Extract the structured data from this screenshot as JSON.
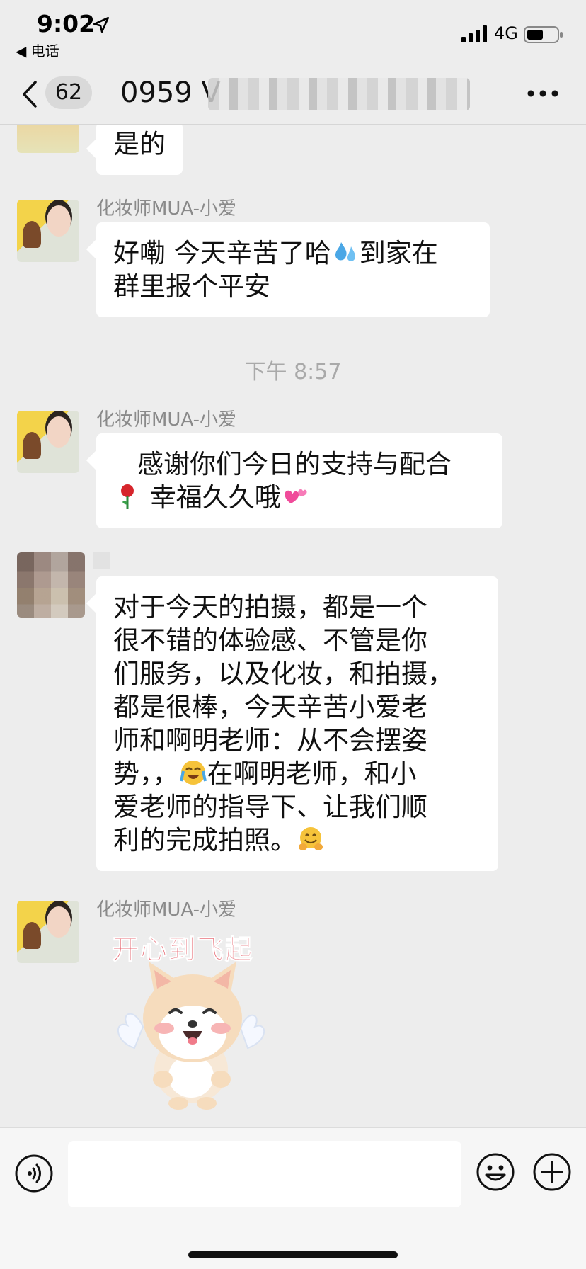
{
  "status_bar": {
    "time": "9:02",
    "back_app": "◀ 电话",
    "network": "4G"
  },
  "nav": {
    "unread_count": "62",
    "title": "0959 V"
  },
  "messages": [
    {
      "type": "text",
      "text": "是的"
    },
    {
      "type": "text",
      "sender": "化妆师MUA-小爱",
      "text_1": "好嘞 今天辛苦了哈",
      "text_2": "到家在",
      "text_3": "群里报个平安"
    },
    {
      "type": "timestamp",
      "text": "下午 8:57"
    },
    {
      "type": "text",
      "sender": "化妆师MUA-小爱",
      "text_1": "感谢你们今日的支持与配合",
      "text_2": "幸福久久哦"
    },
    {
      "type": "text",
      "lines": [
        "对于今天的拍摄，都是一个",
        "很不错的体验感、不管是你",
        "们服务，以及化妆，和拍摄，",
        "都是很棒，今天辛苦小爱老",
        "师和啊明老师：从不会摆姿",
        "在啊明老师，和小",
        "爱老师的指导下、让我们顺",
        "利的完成拍照。"
      ],
      "line_6_prefix": "势，，"
    },
    {
      "type": "sticker",
      "sender": "化妆师MUA-小爱",
      "caption": "开心到飞起"
    }
  ],
  "input": {
    "placeholder": ""
  },
  "icons": {
    "back": "chevron-left-icon",
    "more": "more-dots-icon",
    "voice": "voice-icon",
    "emoji": "emoji-icon",
    "plus": "plus-icon",
    "emoji_sweat": "sweat-droplets-emoji",
    "emoji_rose": "rose-emoji",
    "emoji_hearts": "two-hearts-emoji",
    "emoji_laugh": "loudly-crying-emoji",
    "emoji_hug": "hugging-face-emoji"
  },
  "colors": {
    "background": "#ededed",
    "bubble": "#ffffff",
    "sticker_text": "#e6646e"
  }
}
